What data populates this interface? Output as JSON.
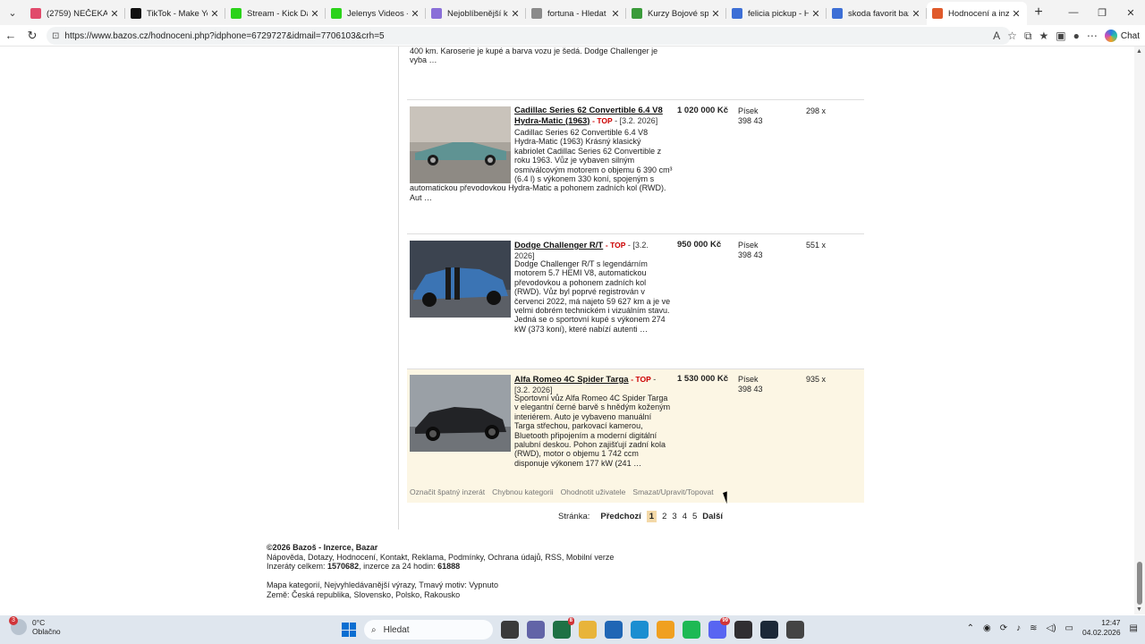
{
  "browser": {
    "tabs": [
      {
        "title": "(2759) NEČEKANÝ BI",
        "favicon_color": "#e14a6b",
        "icon": "youtube-icon"
      },
      {
        "title": "TikTok - Make Your D",
        "favicon_color": "#111111",
        "icon": "tiktok-icon"
      },
      {
        "title": "Stream - Kick Dashb",
        "favicon_color": "#2bd21a",
        "icon": "kick-icon"
      },
      {
        "title": "Jelenys Videos - Wa",
        "favicon_color": "#2bd21a",
        "icon": "kick-icon"
      },
      {
        "title": "Nejoblíbenější kanál",
        "favicon_color": "#8a6fd8",
        "icon": "twitch-icon"
      },
      {
        "title": "fortuna - Hledat",
        "favicon_color": "#8b8b8b",
        "icon": "search-icon"
      },
      {
        "title": "Kurzy Bojové sporty",
        "favicon_color": "#3a9b3a",
        "icon": "globe-icon"
      },
      {
        "title": "felicia pickup - Hleda",
        "favicon_color": "#3d6fd6",
        "icon": "search-icon"
      },
      {
        "title": "skoda favorit bazos",
        "favicon_color": "#3d6fd6",
        "icon": "search-icon"
      },
      {
        "title": "Hodnocení a inzerát",
        "favicon_color": "#e05a2b",
        "icon": "bazos-icon",
        "active": true
      }
    ],
    "url": "https://www.bazos.cz/hodnoceni.php?idphone=6729727&idmail=7706103&crh=5",
    "chat_label": "Chat"
  },
  "page": {
    "prev_tail": "400 km. Karoserie je kupé a barva vozu je šedá. Dodge Challenger je vyba …",
    "listings": [
      {
        "title": "Cadillac Series 62 Convertible 6.4 V8 Hydra-Matic (1963)",
        "top": "TOP",
        "date": "[3.2. 2026]",
        "desc": "Cadillac Series 62 Convertible 6.4 V8 Hydra-Matic (1963) Krásný klasický kabriolet Cadillac Series 62 Convertible z roku 1963. Vůz je vybaven silným osmiválcovým motorem o objemu 6 390 cm³ (6.4 l) s výkonem 330 koní, spojeným s automatickou převodovkou Hydra-Matic a pohonem zadních kol (RWD). Aut …",
        "price": "1 020 000 Kč",
        "loc1": "Písek",
        "loc2": "398 43",
        "views": "298 x",
        "car_color": "#5f9393",
        "highlight": false
      },
      {
        "title": "Dodge Challenger R/T",
        "top": "TOP",
        "date": "[3.2. 2026]",
        "desc": "Dodge Challenger R/T s legendárním motorem 5.7 HEMI V8, automatickou převodovkou a pohonem zadních kol (RWD). Vůz byl poprvé registrován v červenci 2022, má najeto 59 627 km a je ve velmi dobrém technickém i vizuálním stavu. Jedná se o sportovní kupé s výkonem 274 kW (373 koní), které nabízí autenti …",
        "price": "950 000 Kč",
        "loc1": "Písek",
        "loc2": "398 43",
        "views": "551 x",
        "car_color": "#3b74b4",
        "highlight": false
      },
      {
        "title": "Alfa Romeo 4C Spider Targa",
        "top": "TOP",
        "date": "[3.2. 2026]",
        "desc": "Sportovní vůz Alfa Romeo 4C Spider Targa v elegantní černé barvě s hnědým koženým interiérem. Auto je vybaveno manuální Targa střechou, parkovací kamerou, Bluetooth připojením a moderní digitální palubní deskou. Pohon zajišťují zadní kola (RWD), motor o objemu 1 742 ccm disponuje výkonem 177 kW (241 …",
        "price": "1 530 000 Kč",
        "loc1": "Písek",
        "loc2": "398 43",
        "views": "935 x",
        "car_color": "#222326",
        "highlight": true
      }
    ],
    "actions": [
      "Označit špatný inzerát",
      "Chybnou kategorii",
      "Ohodnotit uživatele",
      "Smazat/Upravit/Topovat"
    ],
    "pager": {
      "label": "Stránka:",
      "prev": "Předchozí",
      "pages": [
        "1",
        "2",
        "3",
        "4",
        "5"
      ],
      "current": "1",
      "next": "Další"
    },
    "footer": {
      "copyright": "©2026 Bazoš - ",
      "brand": "Inzerce, Bazar",
      "links1": "Nápověda, Dotazy, Hodnocení, Kontakt, Reklama, Podmínky, Ochrana údajů, RSS, Mobilní verze",
      "stats_label1": "Inzeráty celkem: ",
      "stats_val1": "1570682",
      "stats_label2": ", inzerce za 24 hodin: ",
      "stats_val2": "61888",
      "links2": "Mapa kategorií, Nejvyhledávanější výrazy, Tmavý motiv: Vypnuto",
      "countries": "Země: Česká republika, Slovensko, Polsko, Rakousko"
    }
  },
  "taskbar": {
    "temp": "0°C",
    "weather": "Oblačno",
    "weather_badge": "3",
    "search_placeholder": "Hledat",
    "time": "12:47",
    "date": "04.02.2026",
    "apps": [
      {
        "icon": "file-manager-icon",
        "color": "#3a3a3a"
      },
      {
        "icon": "teams-icon",
        "color": "#6264a7"
      },
      {
        "icon": "excel-icon",
        "color": "#1e7145",
        "badge": "8"
      },
      {
        "icon": "folder-icon",
        "color": "#e8b43a"
      },
      {
        "icon": "store-icon",
        "color": "#2066b5"
      },
      {
        "icon": "edge-icon",
        "color": "#1b8ed1"
      },
      {
        "icon": "winamp-icon",
        "color": "#f0a020"
      },
      {
        "icon": "spotify-icon",
        "color": "#1db954"
      },
      {
        "icon": "discord-icon",
        "color": "#5865f2",
        "badge": "99"
      },
      {
        "icon": "obs-icon",
        "color": "#302e31"
      },
      {
        "icon": "steam-icon",
        "color": "#1b2838"
      },
      {
        "icon": "calculator-icon",
        "color": "#444444"
      }
    ]
  }
}
